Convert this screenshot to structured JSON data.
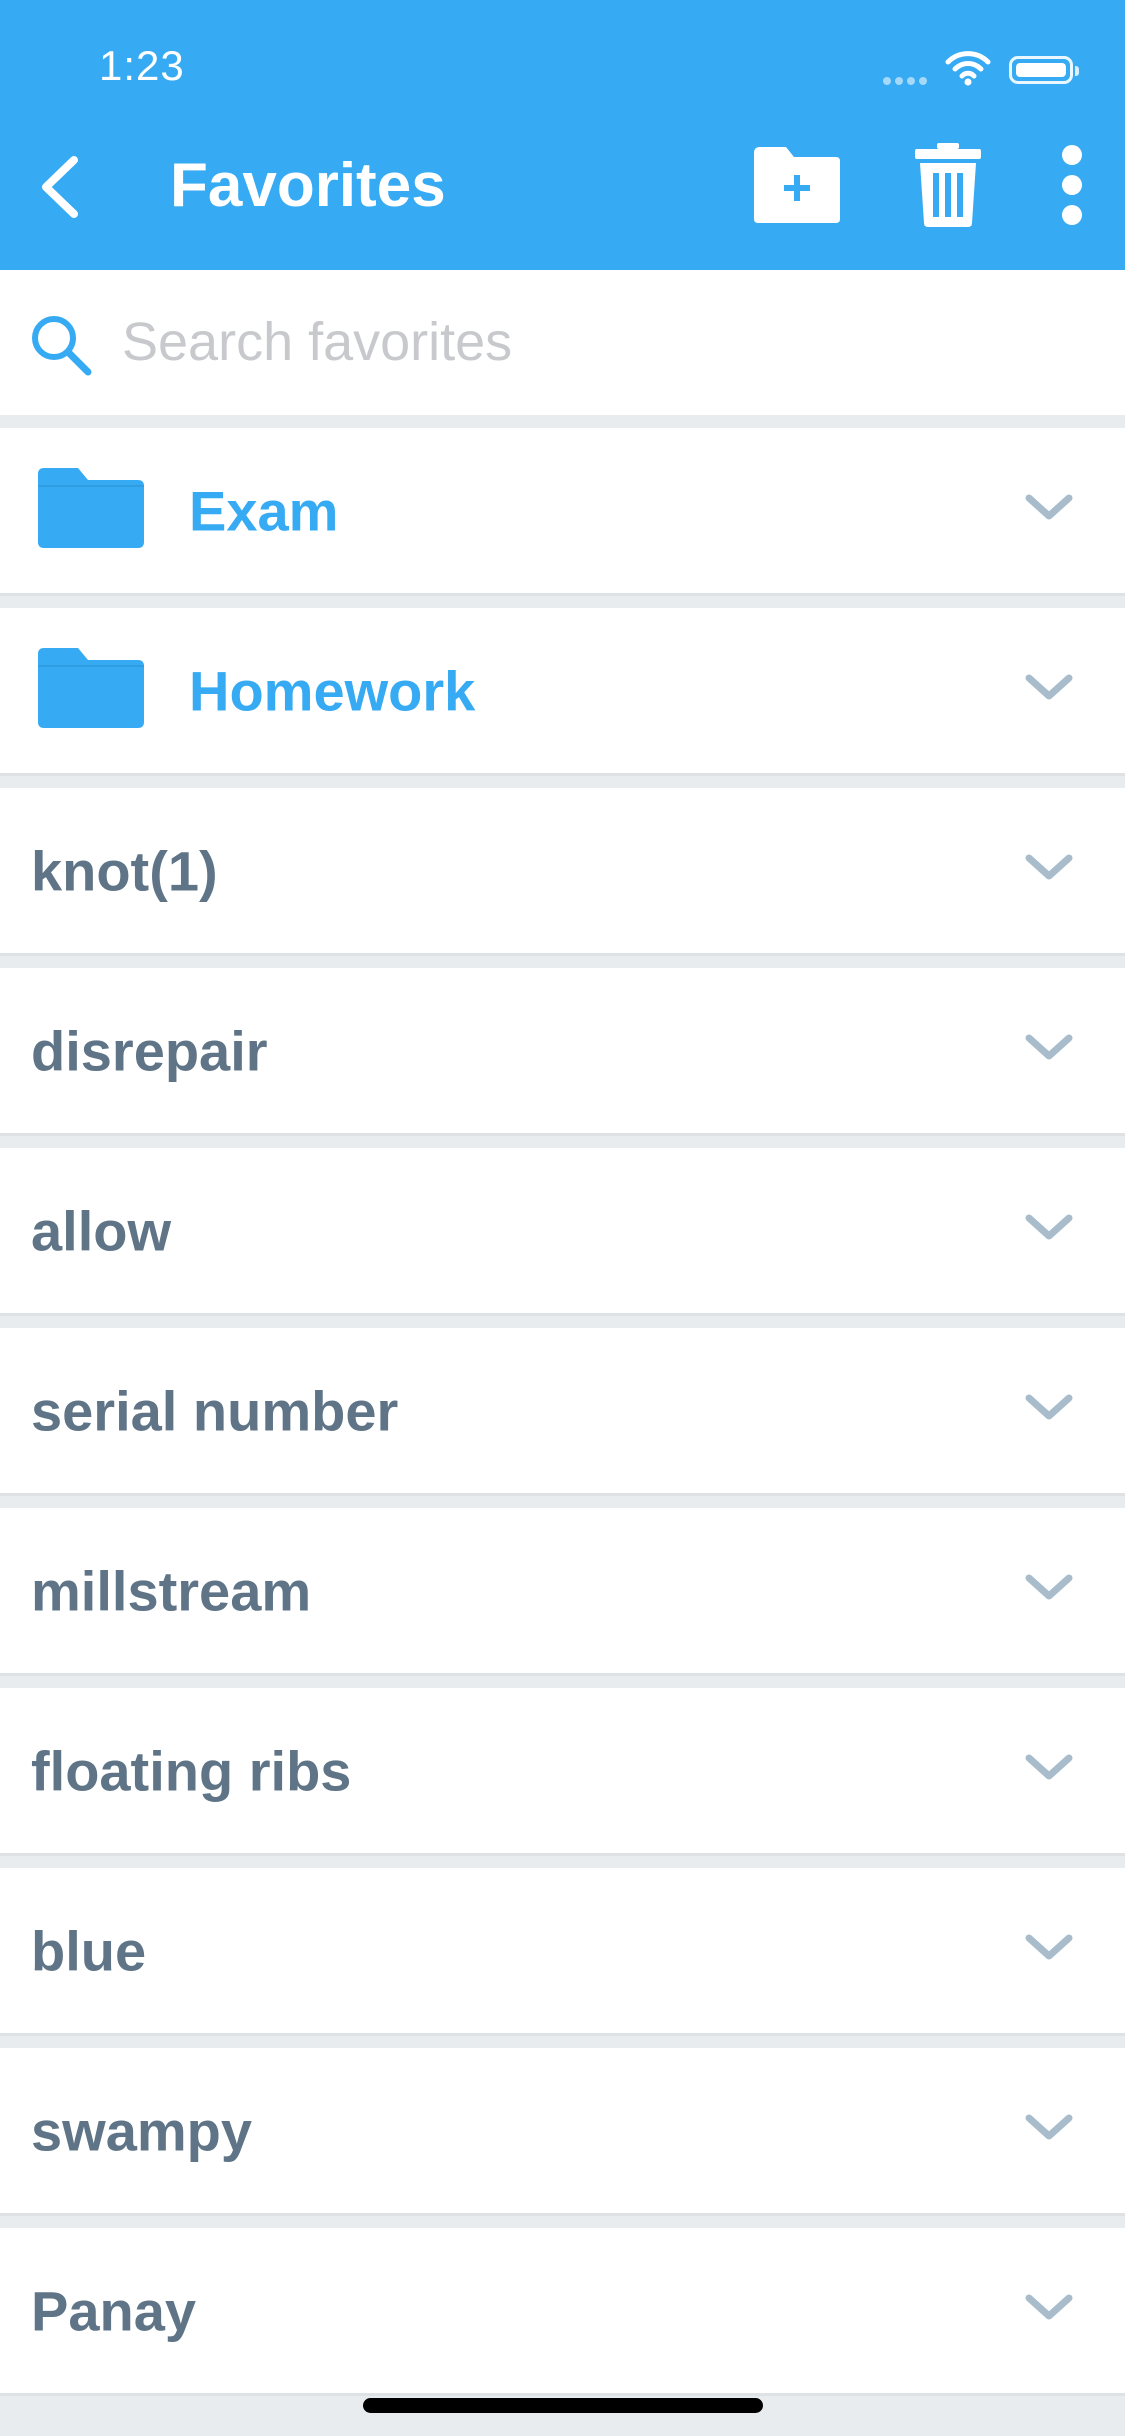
{
  "status_bar": {
    "time": "1:23"
  },
  "nav": {
    "title": "Favorites",
    "back_icon": "chevron-left-icon",
    "actions": [
      {
        "name": "add-folder-button",
        "icon": "folder-plus-icon"
      },
      {
        "name": "delete-button",
        "icon": "trash-icon"
      },
      {
        "name": "more-button",
        "icon": "more-vertical-icon"
      }
    ]
  },
  "search": {
    "placeholder": "Search favorites",
    "value": ""
  },
  "list": {
    "folders": [
      {
        "label": "Exam",
        "icon": "folder-icon"
      },
      {
        "label": "Homework",
        "icon": "folder-icon"
      }
    ],
    "items": [
      {
        "label": "knot(1)"
      },
      {
        "label": "disrepair"
      },
      {
        "label": "allow"
      },
      {
        "label": "serial number"
      },
      {
        "label": "millstream"
      },
      {
        "label": "floating ribs"
      },
      {
        "label": "blue"
      },
      {
        "label": "swampy"
      },
      {
        "label": "Panay"
      }
    ]
  },
  "colors": {
    "accent": "#36aaf2",
    "item_text": "#5f7587",
    "chevron": "#a8bccb",
    "background": "#e9ecef"
  }
}
